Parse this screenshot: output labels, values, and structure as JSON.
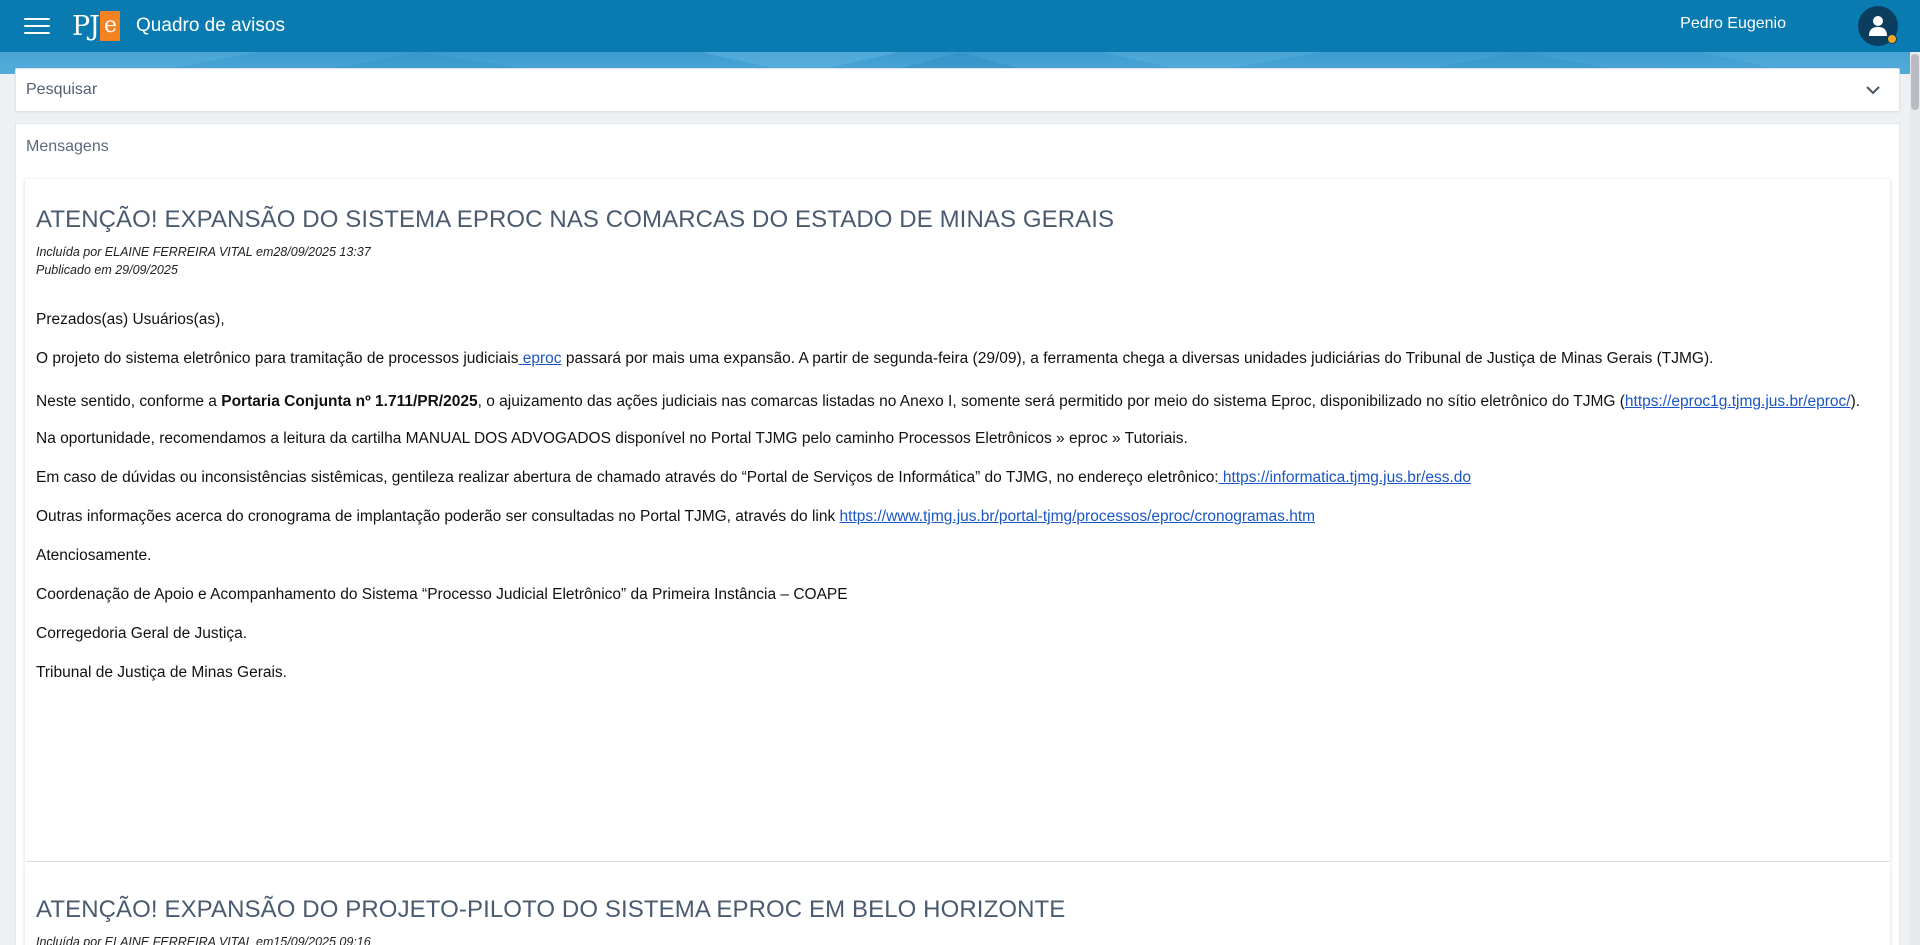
{
  "header": {
    "logo_text": "PJ",
    "logo_accent": "e",
    "title": "Quadro de avisos",
    "user_name": "Pedro Eugenio"
  },
  "search": {
    "label": "Pesquisar"
  },
  "panel": {
    "title": "Mensagens"
  },
  "messages": [
    {
      "title": "ATENÇÃO! EXPANSÃO DO SISTEMA EPROC NAS COMARCAS DO ESTADO DE MINAS GERAIS",
      "included_by": "Incluída por ELAINE FERREIRA VITAL em28/09/2025 13:37",
      "published": "Publicado em 29/09/2025",
      "greeting": "Prezados(as) Usuários(as),",
      "p1_a": "O projeto do sistema eletrônico para tramitação de processos judiciais",
      "p1_link": " eproc",
      "p1_b": " passará por mais uma expansão. A partir de segunda-feira (29/09), a ferramenta chega a diversas unidades judiciárias do Tribunal de Justiça de Minas Gerais (TJMG).",
      "p2_a": "Neste sentido, conforme a ",
      "p2_bold": "Portaria Conjunta nº 1.711/PR/2025",
      "p2_b": ", o ajuizamento das ações judiciais nas comarcas listadas no Anexo I, somente será permitido por meio do sistema Eproc, disponibilizado no sítio eletrônico do TJMG (",
      "p2_link": "https://eproc1g.tjmg.jus.br/eproc/",
      "p2_c": ").",
      "p3": "Na oportunidade, recomendamos a leitura da cartilha MANUAL DOS ADVOGADOS disponível no Portal TJMG pelo caminho Processos Eletrônicos » eproc » Tutoriais.",
      "p4_a": "Em caso de dúvidas ou inconsistências sistêmicas, gentileza realizar abertura de chamado através do “Portal de Serviços de Informática” do TJMG, no endereço eletrônico:",
      "p4_link": " https://informatica.tjmg.jus.br/ess.do",
      "p5_a": "Outras informações acerca do cronograma de implantação poderão ser consultadas no Portal TJMG, através do link ",
      "p5_link": "https://www.tjmg.jus.br/portal-tjmg/processos/eproc/cronogramas.htm",
      "p6": "Atenciosamente.",
      "p7": "Coordenação de Apoio e Acompanhamento do Sistema “Processo Judicial Eletrônico” da Primeira Instância – COAPE",
      "p8": "Corregedoria Geral de Justiça.",
      "p9": "Tribunal de Justiça de Minas Gerais."
    },
    {
      "title": "ATENÇÃO! EXPANSÃO DO PROJETO-PILOTO DO SISTEMA EPROC EM BELO HORIZONTE",
      "included_by": "Incluída por ELAINE FERREIRA VITAL em15/09/2025 09:16"
    }
  ],
  "colors": {
    "header_bg": "#0a7bb1",
    "logo_accent_bg": "#f58220",
    "title_text": "#4a5b70",
    "link": "#1a56c4",
    "avatar_status": "#f5a623"
  },
  "icons": [
    "menu-icon",
    "user-icon",
    "chevron-down-icon"
  ]
}
